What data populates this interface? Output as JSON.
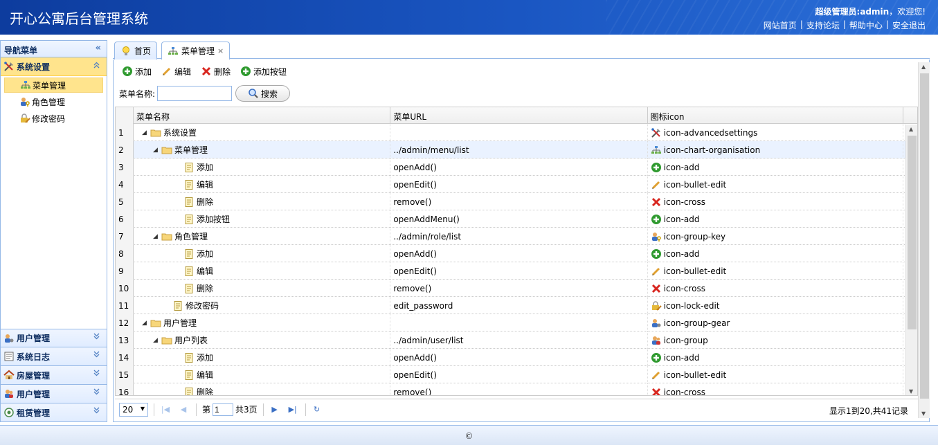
{
  "header": {
    "title": "开心公寓后台管理系统",
    "user_text": "超级管理员:admin",
    "welcome": "，欢迎您!",
    "links": [
      "网站首页",
      "支持论坛",
      "帮助中心",
      "安全退出"
    ],
    "separator": "|"
  },
  "sidebar": {
    "title": "导航菜单",
    "collapse_glyph": "«",
    "sections": [
      {
        "label": "系统设置",
        "icon": "advanced-settings-icon",
        "expanded": true,
        "items": [
          {
            "label": "菜单管理",
            "icon": "chart-organisation-icon",
            "selected": true
          },
          {
            "label": "角色管理",
            "icon": "group-key-icon"
          },
          {
            "label": "修改密码",
            "icon": "lock-edit-icon"
          }
        ]
      },
      {
        "label": "用户管理",
        "icon": "group-gear-icon"
      },
      {
        "label": "系统日志",
        "icon": "log-icon"
      },
      {
        "label": "房屋管理",
        "icon": "house-icon"
      },
      {
        "label": "用户管理",
        "icon": "group-icon"
      },
      {
        "label": "租赁管理",
        "icon": "rent-icon"
      }
    ]
  },
  "tabs": [
    {
      "label": "首页",
      "icon": "lightbulb-icon",
      "active": false
    },
    {
      "label": "菜单管理",
      "icon": "chart-organisation-icon",
      "active": true,
      "close": "×"
    }
  ],
  "toolbar": {
    "add": "添加",
    "edit": "编辑",
    "delete": "删除",
    "add_button": "添加按钮"
  },
  "search": {
    "label": "菜单名称:",
    "value": "",
    "button": "搜索"
  },
  "grid": {
    "columns": [
      "菜单名称",
      "菜单URL",
      "图标icon"
    ],
    "rows": [
      {
        "n": "1",
        "level": 0,
        "folder": true,
        "name": "系统设置",
        "url": "",
        "icon": "icon-advancedsettings"
      },
      {
        "n": "2",
        "level": 1,
        "folder": true,
        "name": "菜单管理",
        "url": "../admin/menu/list",
        "icon": "icon-chart-organisation",
        "hl": true
      },
      {
        "n": "3",
        "level": 2,
        "folder": false,
        "name": "添加",
        "url": "openAdd()",
        "icon": "icon-add"
      },
      {
        "n": "4",
        "level": 2,
        "folder": false,
        "name": "编辑",
        "url": "openEdit()",
        "icon": "icon-bullet-edit"
      },
      {
        "n": "5",
        "level": 2,
        "folder": false,
        "name": "删除",
        "url": "remove()",
        "icon": "icon-cross"
      },
      {
        "n": "6",
        "level": 2,
        "folder": false,
        "name": "添加按钮",
        "url": "openAddMenu()",
        "icon": "icon-add"
      },
      {
        "n": "7",
        "level": 1,
        "folder": true,
        "name": "角色管理",
        "url": "../admin/role/list",
        "icon": "icon-group-key"
      },
      {
        "n": "8",
        "level": 2,
        "folder": false,
        "name": "添加",
        "url": "openAdd()",
        "icon": "icon-add"
      },
      {
        "n": "9",
        "level": 2,
        "folder": false,
        "name": "编辑",
        "url": "openEdit()",
        "icon": "icon-bullet-edit"
      },
      {
        "n": "10",
        "level": 2,
        "folder": false,
        "name": "删除",
        "url": "remove()",
        "icon": "icon-cross"
      },
      {
        "n": "11",
        "level": 1,
        "folder": false,
        "name": "修改密码",
        "url": "edit_password",
        "icon": "icon-lock-edit"
      },
      {
        "n": "12",
        "level": 0,
        "folder": true,
        "name": "用户管理",
        "url": "",
        "icon": "icon-group-gear"
      },
      {
        "n": "13",
        "level": 1,
        "folder": true,
        "name": "用户列表",
        "url": "../admin/user/list",
        "icon": "icon-group"
      },
      {
        "n": "14",
        "level": 2,
        "folder": false,
        "name": "添加",
        "url": "openAdd()",
        "icon": "icon-add"
      },
      {
        "n": "15",
        "level": 2,
        "folder": false,
        "name": "编辑",
        "url": "openEdit()",
        "icon": "icon-bullet-edit"
      },
      {
        "n": "16",
        "level": 2,
        "folder": false,
        "name": "删除",
        "url": "remove()",
        "icon": "icon-cross"
      }
    ]
  },
  "pager": {
    "page_size": "20",
    "page_prefix": "第",
    "page": "1",
    "page_suffix": "共3页",
    "info": "显示1到20,共41记录"
  },
  "footer": {
    "text": "©"
  },
  "colors": {
    "accent": "#95b8e7",
    "selected": "#ffe48d",
    "header": "#1a56c2"
  }
}
